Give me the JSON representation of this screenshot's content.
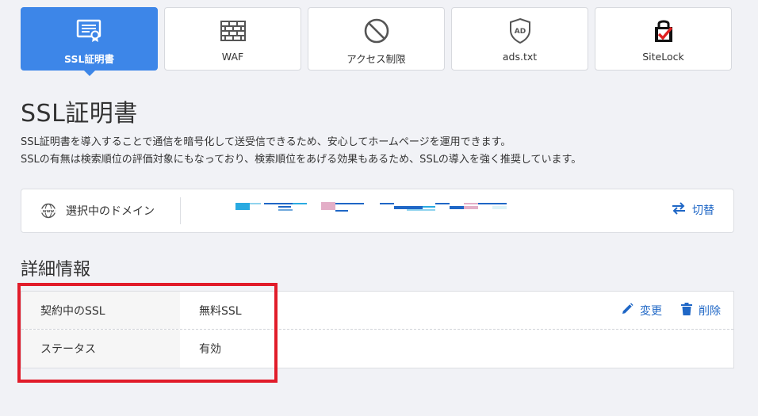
{
  "tabs": [
    {
      "label": "SSL証明書",
      "icon": "certificate-icon",
      "active": true
    },
    {
      "label": "WAF",
      "icon": "firewall-icon",
      "active": false
    },
    {
      "label": "アクセス制限",
      "icon": "prohibited-icon",
      "active": false
    },
    {
      "label": "ads.txt",
      "icon": "ad-shield-icon",
      "active": false
    },
    {
      "label": "SiteLock",
      "icon": "sitelock-icon",
      "active": false
    }
  ],
  "page": {
    "title": "SSL証明書",
    "desc_line1": "SSL証明書を導入することで通信を暗号化して送受信できるため、安心してホームページを運用できます。",
    "desc_line2": "SSLの有無は検索順位の評価対象にもなっており、検索順位をあげる効果もあるため、SSLの導入を強く推奨しています。"
  },
  "domain": {
    "label": "選択中のドメイン",
    "icon": "www-globe-icon",
    "switch_label": "切替",
    "switch_icon": "swap-arrows-icon"
  },
  "detail": {
    "title": "詳細情報",
    "rows": [
      {
        "key": "契約中のSSL",
        "value": "無料SSL"
      },
      {
        "key": "ステータス",
        "value": "有効"
      }
    ],
    "edit_label": "変更",
    "edit_icon": "pencil-icon",
    "delete_label": "削除",
    "delete_icon": "trash-icon"
  },
  "colors": {
    "accent": "#3d86e8",
    "link": "#1f67c6",
    "highlight": "#e11c2a"
  }
}
